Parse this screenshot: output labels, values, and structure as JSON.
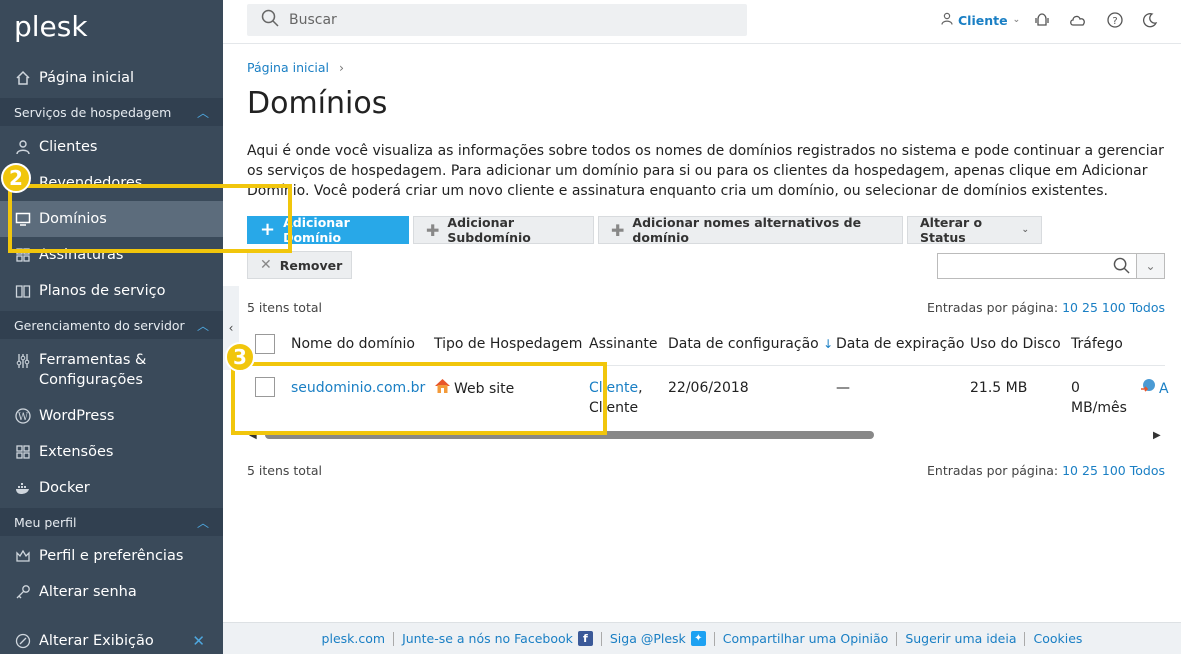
{
  "sidebar": {
    "logo": "plesk",
    "items": {
      "home": "Página inicial",
      "section_hosting": "Serviços de hospedagem",
      "clients": "Clientes",
      "resellers": "Revendedores",
      "domains": "Domínios",
      "subscriptions": "Assinaturas",
      "plans": "Planos de serviço",
      "section_server": "Gerenciamento do servidor",
      "tools_line1": "Ferramentas &",
      "tools_line2": "Configurações",
      "wordpress": "WordPress",
      "extensions": "Extensões",
      "docker": "Docker",
      "section_profile": "Meu perfil",
      "profile": "Perfil e preferências",
      "password": "Alterar senha",
      "view": "Alterar Exibição"
    }
  },
  "header": {
    "search_placeholder": "Buscar",
    "client_label": "Cliente"
  },
  "breadcrumb": {
    "home": "Página inicial"
  },
  "page": {
    "title": "Domínios",
    "intro": "Aqui é onde você visualiza as informações sobre todos os nomes de domínios registrados no sistema e pode continuar a gerenciar os serviços de hospedagem. Para adicionar um domínio para si ou para os clientes da hospedagem, apenas clique em Adicionar Domínio. Você poderá criar um novo cliente e assinatura enquanto cria um domínio, ou selecionar de domínios existentes."
  },
  "toolbar": {
    "add_domain": "Adicionar Domínio",
    "add_subdomain": "Adicionar Subdomínio",
    "add_alias": "Adicionar nomes alternativos de domínio",
    "change_status": "Alterar o Status",
    "remove": "Remover"
  },
  "list": {
    "total_top": "5 itens total",
    "total_bottom": "5 itens total",
    "per_page_label": "Entradas por página:",
    "per_page_options": [
      "10",
      "25",
      "100",
      "Todos"
    ],
    "columns": {
      "domain": "Nome do domínio",
      "hosting": "Tipo de Hospedagem",
      "subscriber": "Assinante",
      "setup_date": "Data de configuração",
      "sort_arrow": "↓",
      "expiration": "Data de expiração",
      "disk": "Uso do Disco",
      "traffic": "Tráfego"
    },
    "rows": [
      {
        "domain": "seudominio.com.br",
        "hosting": "Web site",
        "subscriber_link": "Cliente",
        "subscriber_sep": ",",
        "subscriber_name": "Cliente",
        "setup_date": "22/06/2018",
        "expiration": "—",
        "disk": "21.5 MB",
        "traffic_line1": "0",
        "traffic_line2": "MB/mês",
        "extra": "A"
      }
    ]
  },
  "footer": {
    "links": [
      "plesk.com",
      "Junte-se a nós no Facebook",
      "Siga @Plesk",
      "Compartilhar uma Opinião",
      "Sugerir uma ideia",
      "Cookies"
    ]
  },
  "annotations": {
    "step2": "2",
    "step3": "3"
  },
  "colors": {
    "sidebar": "#3a4a5a",
    "accent": "#28a8e8",
    "link": "#1a7fc4",
    "callout": "#f1c60c"
  }
}
